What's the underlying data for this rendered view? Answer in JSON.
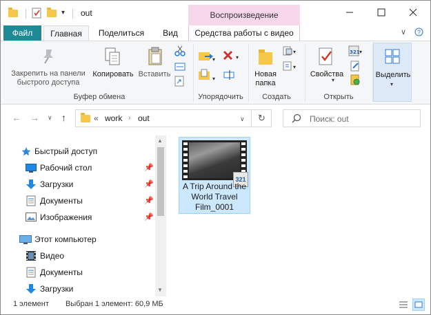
{
  "titlebar": {
    "title": "out",
    "context_tab_header": "Воспроизведение",
    "window_controls": [
      "minimize",
      "maximize",
      "close"
    ]
  },
  "tabs": {
    "file": "Файл",
    "home": "Главная",
    "share": "Поделиться",
    "view": "Вид",
    "video_tools": "Средства работы с видео"
  },
  "ribbon": {
    "clipboard": {
      "pin_label": "Закрепить на панели быстрого доступа",
      "copy_label": "Копировать",
      "paste_label": "Вставить",
      "group_label": "Буфер обмена"
    },
    "organize": {
      "group_label": "Упорядочить"
    },
    "new": {
      "new_folder_label": "Новая папка",
      "group_label": "Создать"
    },
    "open": {
      "properties_label": "Свойства",
      "group_label": "Открыть"
    },
    "select": {
      "select_label": "Выделить"
    }
  },
  "address": {
    "path_prefix": "«",
    "crumbs": [
      "work",
      "out"
    ],
    "search_placeholder": "Поиск: out"
  },
  "navpane": {
    "items": [
      {
        "label": "Быстрый доступ",
        "icon": "star-icon",
        "pinned": false
      },
      {
        "label": "Рабочий стол",
        "icon": "desktop-icon",
        "pinned": true
      },
      {
        "label": "Загрузки",
        "icon": "download-icon",
        "pinned": true
      },
      {
        "label": "Документы",
        "icon": "document-icon",
        "pinned": true
      },
      {
        "label": "Изображения",
        "icon": "image-icon",
        "pinned": true
      },
      {
        "label": "Этот компьютер",
        "icon": "computer-icon",
        "pinned": false
      },
      {
        "label": "Видео",
        "icon": "video-icon",
        "pinned": false
      },
      {
        "label": "Документы",
        "icon": "document-icon",
        "pinned": false
      },
      {
        "label": "Загрузки",
        "icon": "download-icon",
        "pinned": false
      }
    ]
  },
  "files": [
    {
      "name": "A Trip Around the World Travel Film_0001",
      "icon": "video-file-icon",
      "selected": true
    }
  ],
  "status": {
    "count": "1 элемент",
    "selection": "Выбран 1 элемент: 60,9 МБ"
  },
  "colors": {
    "file_tab": "#1e8a96",
    "context_tab": "#f8d7ea",
    "selection_bg": "#cce8ff",
    "selection_border": "#99d1ff"
  }
}
